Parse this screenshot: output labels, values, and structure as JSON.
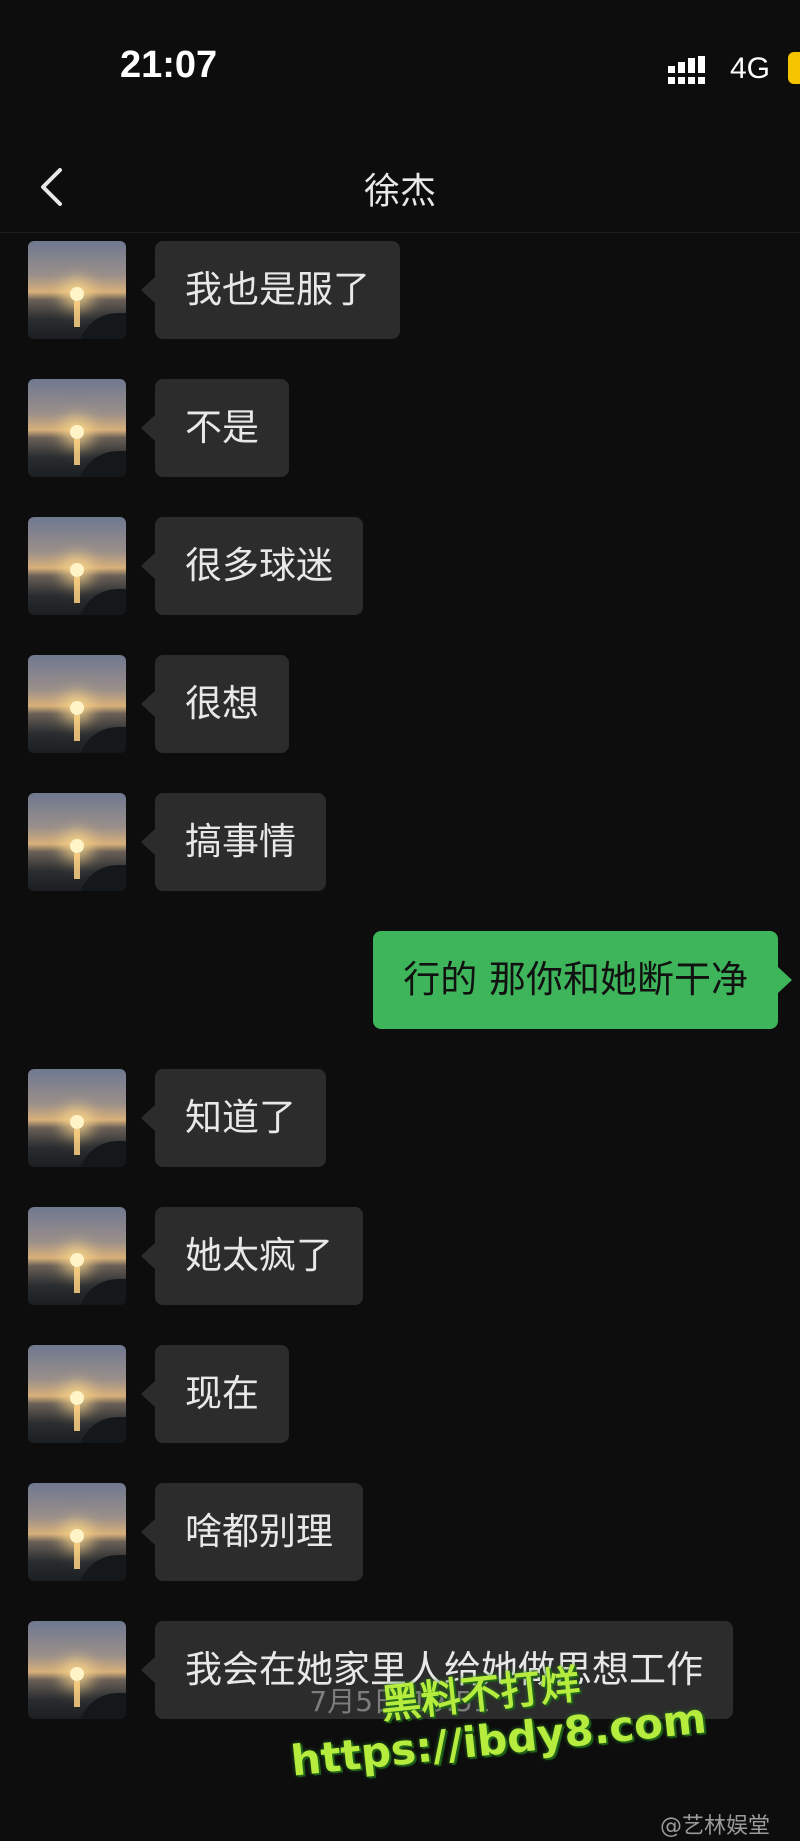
{
  "status": {
    "time": "21:07",
    "network": "4G"
  },
  "header": {
    "title": "徐杰"
  },
  "messages": [
    {
      "dir": "in",
      "text": "我也是服了"
    },
    {
      "dir": "in",
      "text": "不是"
    },
    {
      "dir": "in",
      "text": "很多球迷"
    },
    {
      "dir": "in",
      "text": "很想"
    },
    {
      "dir": "in",
      "text": "搞事情"
    },
    {
      "dir": "out",
      "text": "行的 那你和她断干净"
    },
    {
      "dir": "in",
      "text": "知道了"
    },
    {
      "dir": "in",
      "text": "她太疯了"
    },
    {
      "dir": "in",
      "text": "现在"
    },
    {
      "dir": "in",
      "text": "啥都别理"
    },
    {
      "dir": "in",
      "text": "我会在她家里人给她做思想工作"
    }
  ],
  "timestamp": "7月5日 19:51",
  "watermark": {
    "line1": "黑料不打烊",
    "line2": "https://ibdy8.com"
  },
  "weibo_credit": "@艺林娱堂",
  "colors": {
    "incoming_bubble": "#2c2c2c",
    "outgoing_bubble": "#3eb55a",
    "background": "#0d0d0d",
    "battery": "#f5c400"
  }
}
